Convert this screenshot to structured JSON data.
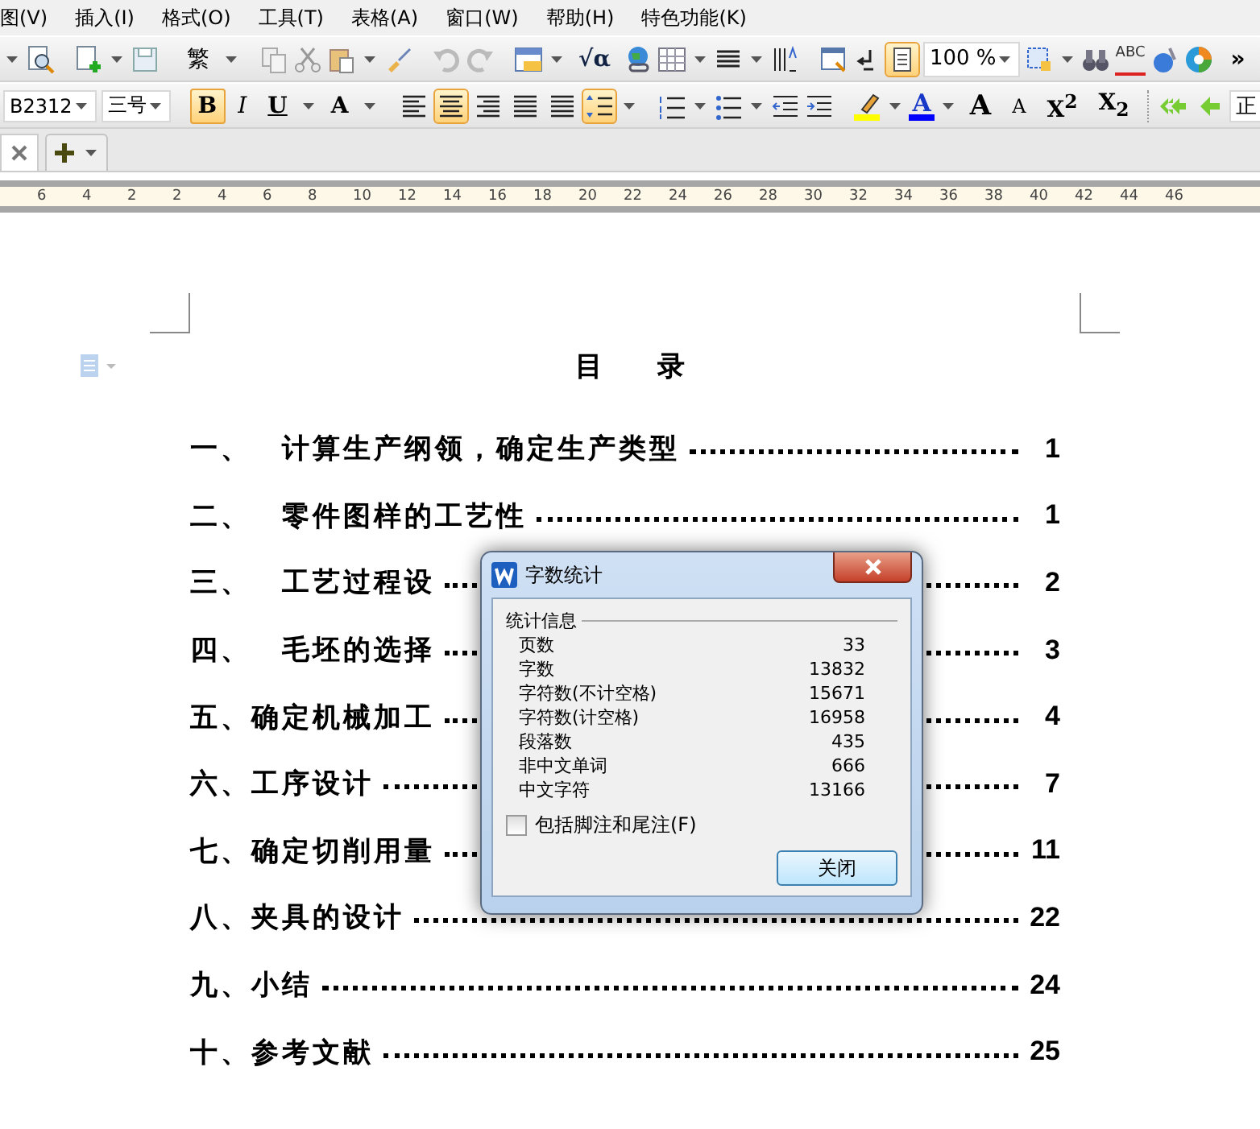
{
  "menu": [
    {
      "label": "图(V)"
    },
    {
      "label": "插入(I)"
    },
    {
      "label": "格式(O)"
    },
    {
      "label": "工具(T)"
    },
    {
      "label": "表格(A)"
    },
    {
      "label": "窗口(W)"
    },
    {
      "label": "帮助(H)"
    },
    {
      "label": "特色功能(K)"
    }
  ],
  "standard_toolbar": {
    "traditional": "繁",
    "formula": "√α",
    "zoom": "100 %",
    "spell": "ABC",
    "page_view": {
      "selected": true
    },
    "overflow": "»"
  },
  "format_toolbar": {
    "font": "B2312",
    "size": "三号",
    "bold": {
      "label": "B",
      "selected": true
    },
    "italic": {
      "label": "I",
      "selected": false
    },
    "underline": {
      "label": "U",
      "selected": false
    },
    "effect_letter": "A",
    "align": [
      {
        "selected": false
      },
      {
        "selected": true
      },
      {
        "selected": false
      },
      {
        "selected": false
      },
      {
        "selected": false
      }
    ],
    "line_spacing": {
      "selected": true
    },
    "font_color_letter": "A",
    "grow_letter": "A",
    "shrink_letter": "A",
    "superscript": "X$^{2}$",
    "subscript": "X$_{2}$",
    "cut_text": "正"
  },
  "ruler": {
    "ticks": [
      "6",
      "4",
      "2",
      "2",
      "4",
      "6",
      "8",
      "10",
      "12",
      "14",
      "16",
      "18",
      "20",
      "22",
      "24",
      "26",
      "28",
      "30",
      "32",
      "34",
      "36",
      "38",
      "40",
      "42",
      "44",
      "46"
    ]
  },
  "document": {
    "title": "目　　录",
    "toc": [
      {
        "label": "一、　计算生产纲领，确定生产类型",
        "page": "1"
      },
      {
        "label": "二、　零件图样的工艺性",
        "page": "1"
      },
      {
        "label": "三、　工艺过程设",
        "page": "2"
      },
      {
        "label": "四、　毛坯的选择",
        "page": "3"
      },
      {
        "label": "五、确定机械加工",
        "page": "4"
      },
      {
        "label": "六、工序设计",
        "page": "7"
      },
      {
        "label": "七、确定切削用量",
        "page": "11"
      },
      {
        "label": "八、夹具的设计",
        "page": "22"
      },
      {
        "label": "九、小结",
        "page": "24"
      },
      {
        "label": "十、参考文献",
        "page": "25"
      }
    ]
  },
  "dialog": {
    "title": "字数统计",
    "group": "统计信息",
    "stats": [
      {
        "label": "页数",
        "value": "33"
      },
      {
        "label": "字数",
        "value": "13832"
      },
      {
        "label": "字符数(不计空格)",
        "value": "15671"
      },
      {
        "label": "字符数(计空格)",
        "value": "16958"
      },
      {
        "label": "段落数",
        "value": "435"
      },
      {
        "label": "非中文单词",
        "value": "666"
      },
      {
        "label": "中文字符",
        "value": "13166"
      }
    ],
    "checkbox": {
      "label": "包括脚注和尾注(F)",
      "checked": false
    },
    "close_button": "关闭"
  }
}
